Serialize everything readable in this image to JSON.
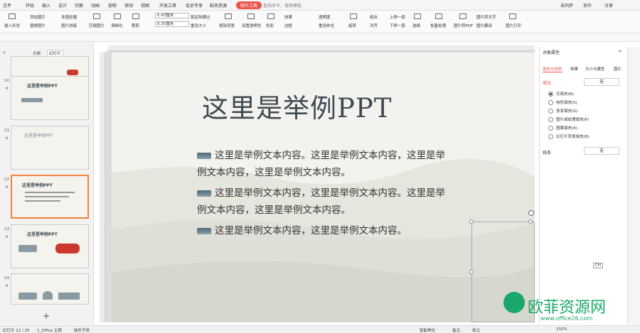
{
  "menu": {
    "items": [
      "文件",
      "开始",
      "插入",
      "设计",
      "切换",
      "动画",
      "放映",
      "审阅",
      "视图",
      "开发工具",
      "会员专享",
      "稻壳资源"
    ],
    "active": "图片工具",
    "search": "查找命令、搜索模板",
    "right": [
      "未同步",
      "协作",
      "分享"
    ]
  },
  "ribbon": {
    "labels": [
      "插入形状",
      "添加图片",
      "多图轮播",
      "替换图片",
      "图片拼接",
      "压缩图片",
      "清晰化",
      "裁剪",
      "重设大小",
      "锁定纵横比",
      "抠除背景",
      "设置透明色",
      "色彩",
      "效果",
      "透明度",
      "边框",
      "重设样式",
      "旋转",
      "对齐",
      "组合",
      "上移一层",
      "下移一层",
      "选择",
      "批量处理",
      "图片转PDF",
      "图片转文字",
      "图片翻译",
      "图片打印"
    ],
    "height": "5.43厘米",
    "width": "6.35厘米"
  },
  "leftpane": {
    "tabs": [
      "大纲",
      "幻灯片"
    ],
    "slides": [
      {
        "num": "10",
        "title": "这里是举例PPT"
      },
      {
        "num": "11",
        "title": "这里是举例PPT"
      },
      {
        "num": "12",
        "title": "这里是举例PPT"
      },
      {
        "num": "13",
        "title": "这里是举例PPT"
      },
      {
        "num": "14",
        "title": ""
      }
    ],
    "add": "+"
  },
  "slide": {
    "title": "这里是举例PPT",
    "paragraphs": [
      "这里是举例文本内容。这里是举例文本内容，这里是举例文本内容，这里是举例文本内容。",
      "这里是举例文本内容，这里是举例文本内容。这里是举例文本内容，这里是举例文本内容。",
      "这里是举例文本内容，这里是举例文本内容。"
    ]
  },
  "rpanel": {
    "title": "对象属性",
    "tabs": [
      "填充与线条",
      "效果",
      "大小与属性",
      "图片"
    ],
    "fill_label": "填充",
    "fill_value": "无",
    "options": [
      "无填充(N)",
      "纯色填充(S)",
      "渐变填充(G)",
      "图片或纹理填充(P)",
      "图案填充(A)",
      "幻灯片背景填充(B)"
    ],
    "line_label": "线条",
    "line_value": "无"
  },
  "status": {
    "slide": "幻灯片 12 / 25",
    "theme": "1_Office 主题",
    "font": "缺失字体",
    "smart": "智能美化",
    "notes": "备注",
    "comments": "批注",
    "zoom": "150%",
    "ime": "CH",
    "watermark": "欧菲资源网",
    "watermark_url": "www.office26.com"
  },
  "colors": {
    "accent": "#e9554b",
    "selection": "#f0823c",
    "title": "#3d4a52"
  }
}
